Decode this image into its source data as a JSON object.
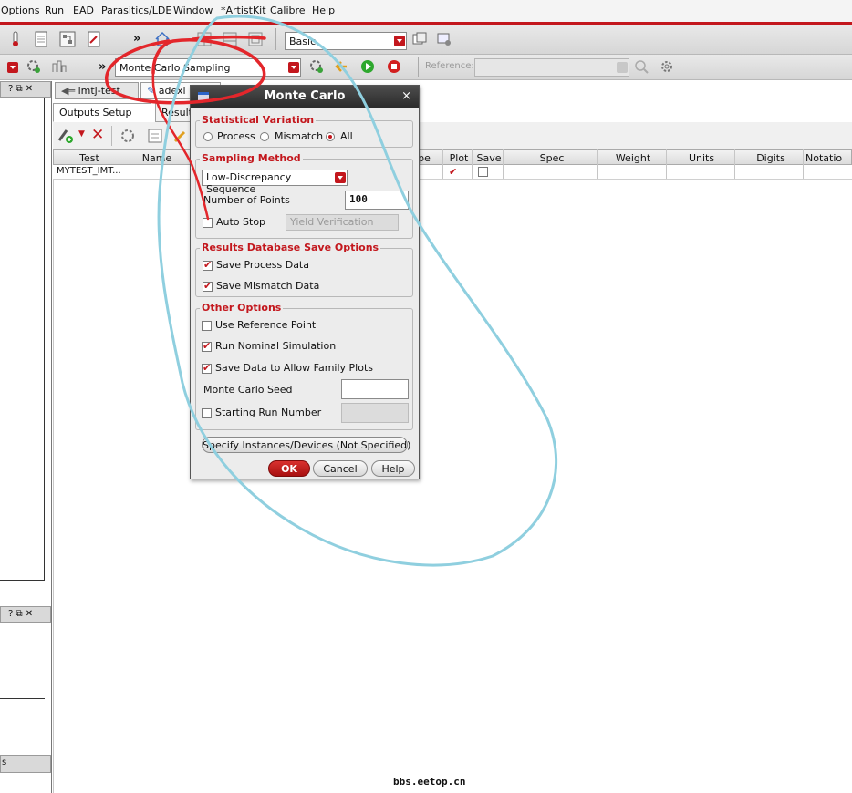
{
  "menubar": {
    "items": [
      "Options",
      "Run",
      "EAD",
      "Parasitics/LDE",
      "Window",
      "*ArtistKit",
      "Calibre",
      "Help"
    ]
  },
  "toolbar1": {
    "more_symbol": "»",
    "workspace_value": "Basic"
  },
  "toolbar2": {
    "more_symbol": "»",
    "run_mode_value": "Monte Carlo Sampling",
    "reference_label": "Reference:",
    "reference_value": ""
  },
  "left_panes": {
    "pane1_controls": "? ⧉ ✕",
    "pane2_controls": "? ⧉ ✕",
    "pane3_label": "s"
  },
  "doc_tabs": [
    {
      "label": "lmtj-test"
    },
    {
      "label": "adexl"
    }
  ],
  "sub_tabs": [
    {
      "label": "Outputs Setup"
    },
    {
      "label": "Results"
    }
  ],
  "grid": {
    "columns": [
      "Test",
      "Name",
      "pe",
      "Plot",
      "Save",
      "Spec",
      "Weight",
      "Units",
      "Digits",
      "Notatio"
    ],
    "rows": [
      {
        "test": "MYTEST_IMT...",
        "name": "",
        "type": "",
        "plot": true,
        "save": false,
        "spec": "",
        "weight": "",
        "units": "",
        "digits": "",
        "notation": ""
      }
    ]
  },
  "dialog": {
    "title": "Monte Carlo",
    "close_symbol": "×",
    "statistical_variation": {
      "title": "Statistical Variation",
      "options": [
        "Process",
        "Mismatch",
        "All"
      ],
      "selected": "All"
    },
    "sampling_method": {
      "title": "Sampling Method",
      "value": "Low-Discrepancy Sequence",
      "num_points_label": "Number of Points",
      "num_points_value": "100",
      "auto_stop_label": "Auto Stop",
      "auto_stop_checked": false,
      "yield_verification_value": "Yield Verification"
    },
    "results_db": {
      "title": "Results Database Save Options",
      "save_process_label": "Save Process Data",
      "save_process_checked": true,
      "save_mismatch_label": "Save Mismatch Data",
      "save_mismatch_checked": true
    },
    "other_options": {
      "title": "Other Options",
      "use_reference_label": "Use Reference Point",
      "use_reference_checked": false,
      "run_nominal_label": "Run Nominal Simulation",
      "run_nominal_checked": true,
      "save_family_label": "Save Data to Allow Family Plots",
      "save_family_checked": true,
      "seed_label": "Monte Carlo Seed",
      "seed_value": "",
      "starting_run_label": "Starting Run Number",
      "starting_run_checked": false,
      "starting_run_value": ""
    },
    "specify_button_label": "Specify Instances/Devices (Not Specified)",
    "ok_label": "OK",
    "cancel_label": "Cancel",
    "help_label": "Help"
  },
  "watermark": "bbs.eetop.cn",
  "colors": {
    "accent_red": "#c3171d",
    "annotation_red": "#e3262b",
    "annotation_blue": "#8fcfdf",
    "title_bar": "#3a3a3a"
  }
}
